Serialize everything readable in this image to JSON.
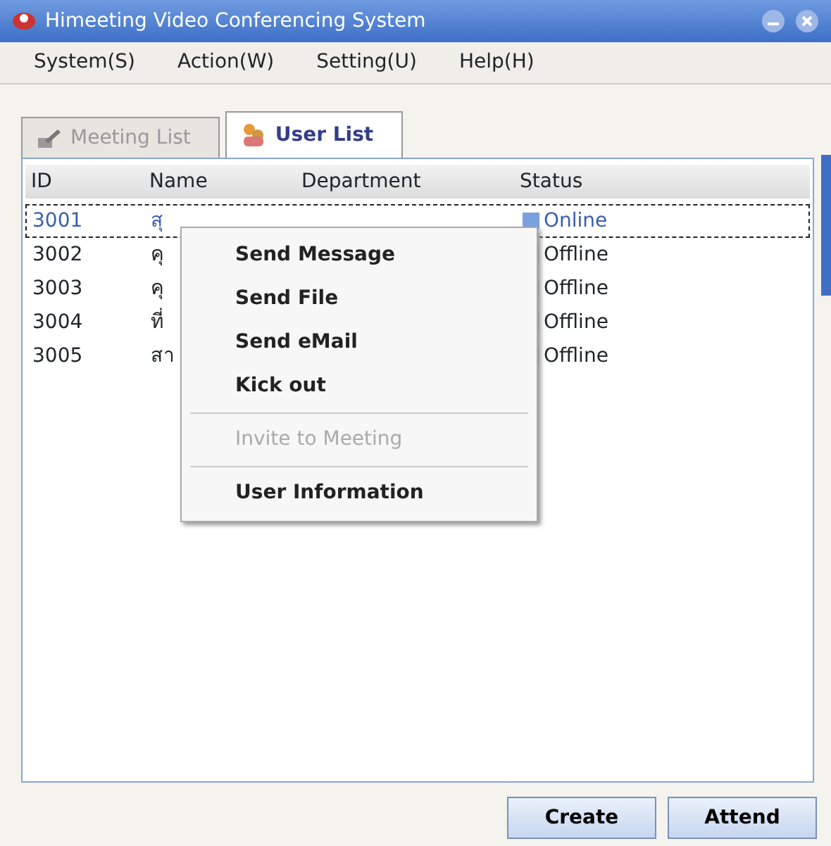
{
  "window": {
    "title": "Himeeting Video Conferencing System"
  },
  "menu_bar": [
    {
      "label": "System(S)"
    },
    {
      "label": "Action(W)"
    },
    {
      "label": "Setting(U)"
    },
    {
      "label": "Help(H)"
    }
  ],
  "tabs": [
    {
      "label": "Meeting List",
      "selected": false,
      "kind": "meeting"
    },
    {
      "label": "User List",
      "selected": true,
      "kind": "users"
    }
  ],
  "table": {
    "columns": [
      "ID",
      "Name",
      "Department",
      "Status"
    ],
    "rows": [
      {
        "id": "3001",
        "name": "สุ",
        "status": "Online",
        "selected": true
      },
      {
        "id": "3002",
        "name": "คุ",
        "status": "Offline",
        "selected": false
      },
      {
        "id": "3003",
        "name": "คุ",
        "status": "Offline",
        "selected": false
      },
      {
        "id": "3004",
        "name": "ที่",
        "status": "Offline",
        "selected": false
      },
      {
        "id": "3005",
        "name": "สา",
        "status": "Offline",
        "selected": false
      }
    ]
  },
  "context_menu": [
    {
      "label": "Send Message",
      "kind": "item",
      "disabled": false
    },
    {
      "label": "Send File",
      "kind": "item",
      "disabled": false
    },
    {
      "label": "Send eMail",
      "kind": "item",
      "disabled": false
    },
    {
      "label": "Kick out",
      "kind": "item",
      "disabled": false
    },
    {
      "kind": "separator"
    },
    {
      "label": "Invite to Meeting",
      "kind": "item",
      "disabled": true
    },
    {
      "kind": "separator"
    },
    {
      "label": "User Information",
      "kind": "item",
      "disabled": false
    }
  ],
  "buttons": [
    "Create",
    "Attend"
  ]
}
